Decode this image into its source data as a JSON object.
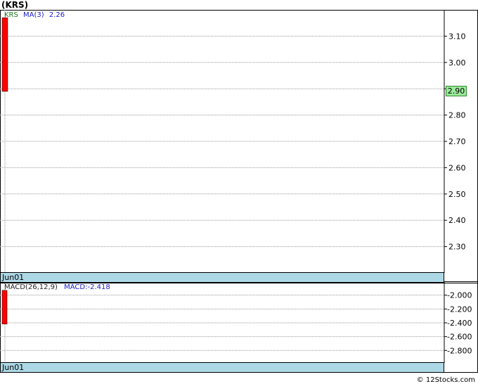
{
  "title": "(KRS)",
  "legend": {
    "symbol": "KRS",
    "ma_label": "MA(3)",
    "ma_value": "2.26",
    "macd_label": "MACD(26,12,9)",
    "macd_value": "MACD:-2.418"
  },
  "date_label_top": "Jun01",
  "date_label_bottom": "Jun01",
  "last_price": "2.90",
  "footer": "© 12Stocks.com",
  "colors": {
    "bar": "#ff0000",
    "grid": "#999999",
    "date_bar": "#add8e6",
    "price_box": "#9be89b"
  },
  "chart_data": [
    {
      "type": "bar",
      "panel": "price",
      "x": [
        "Jun01"
      ],
      "series": [
        {
          "name": "KRS",
          "low": [
            2.89
          ],
          "high": [
            3.17
          ]
        }
      ],
      "yticks": [
        "2.30",
        "2.40",
        "2.50",
        "2.60",
        "2.70",
        "2.80",
        "2.90",
        "3.00",
        "3.10"
      ],
      "ylim": [
        2.2,
        3.2
      ],
      "grid": true
    },
    {
      "type": "bar",
      "panel": "macd",
      "x": [
        "Jun01"
      ],
      "series": [
        {
          "name": "MACD",
          "top": [
            -1.93
          ],
          "bottom": [
            -2.418
          ]
        }
      ],
      "yticks": [
        "-2.000",
        "-2.200",
        "-2.400",
        "-2.600",
        "-2.800"
      ],
      "ylim": [
        -2.98,
        -1.81
      ],
      "grid": true
    }
  ]
}
